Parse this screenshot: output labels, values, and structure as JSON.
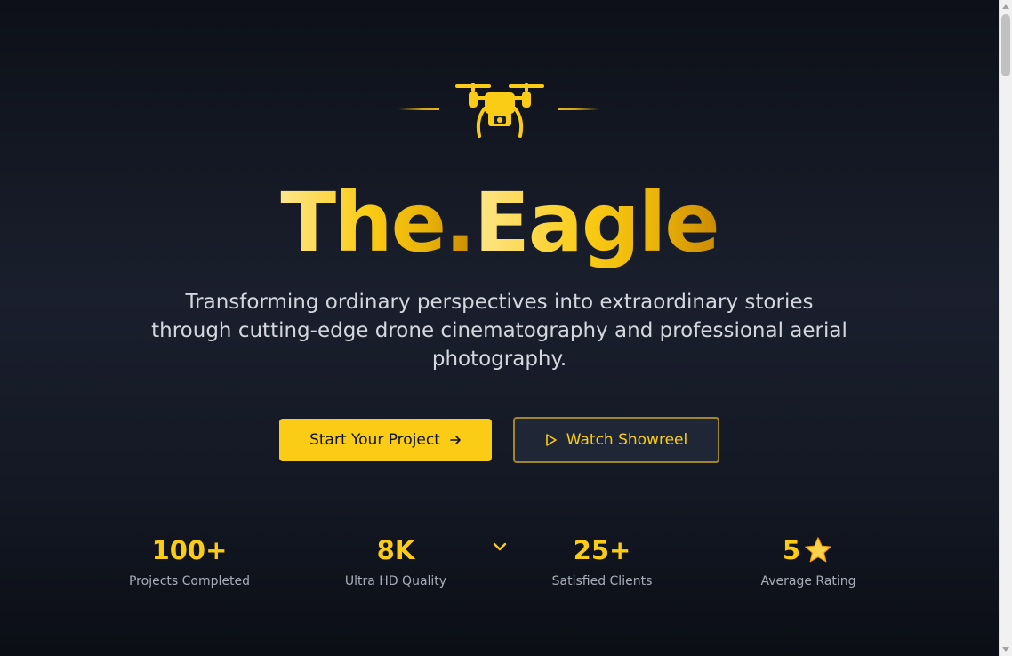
{
  "hero": {
    "brand_part1": "The.",
    "brand_part2": "Eagle",
    "tagline": "Transforming ordinary perspectives into extraordinary stories through cutting-edge drone cinematography and professional aerial photography."
  },
  "actions": {
    "primary_label": "Start Your Project",
    "primary_icon": "arrow-right-icon",
    "secondary_label": "Watch Showreel",
    "secondary_icon": "play-icon"
  },
  "stats": [
    {
      "value": "100+",
      "label": "Projects Completed"
    },
    {
      "value": "8K",
      "label": "Ultra HD Quality"
    },
    {
      "value": "25+",
      "label": "Satisfied Clients"
    },
    {
      "value": "5",
      "label": "Average Rating",
      "icon": "star-icon"
    }
  ],
  "icons": {
    "logo": "drone-icon",
    "scroll": "chevron-down-icon"
  },
  "colors": {
    "accent": "#facc15",
    "background": "#141824",
    "text": "#d4d7de",
    "muted": "#a8adb8"
  }
}
